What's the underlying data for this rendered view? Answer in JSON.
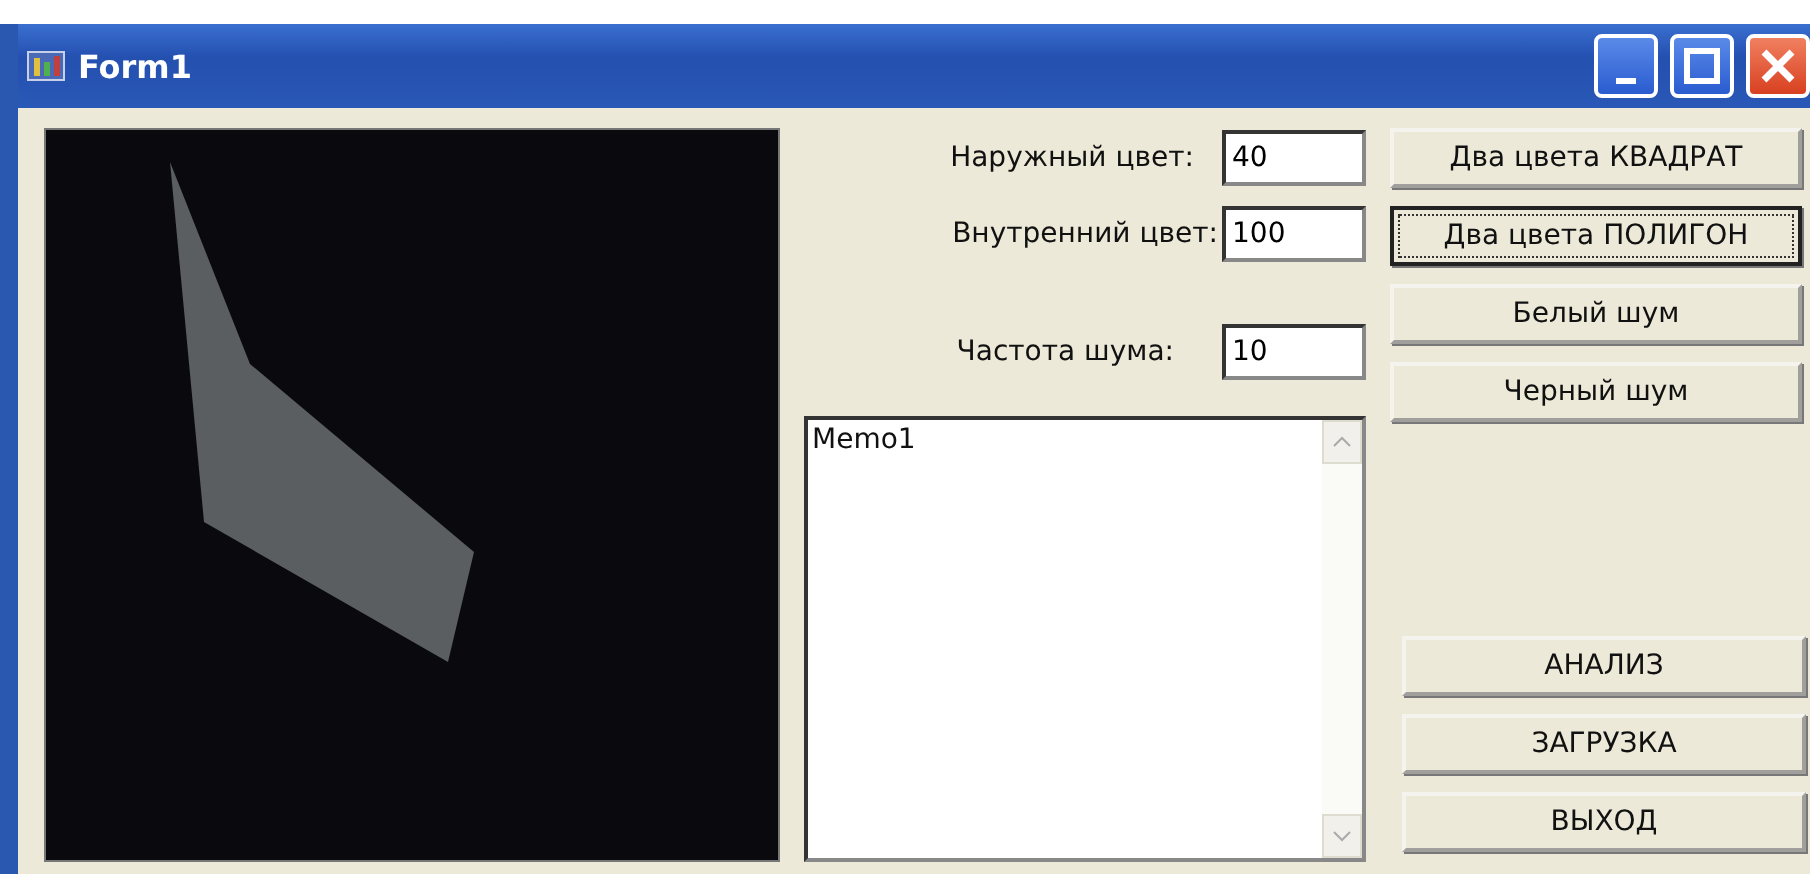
{
  "window": {
    "title": "Form1"
  },
  "fields": [
    {
      "label": "Наружный цвет:",
      "value": "40"
    },
    {
      "label": "Внутренний цвет:",
      "value": "100"
    },
    {
      "label": "Частота шума:",
      "value": "10"
    }
  ],
  "memo": {
    "value": "Memo1"
  },
  "top_buttons": [
    {
      "label": "Два цвета КВАДРАТ",
      "focused": false
    },
    {
      "label": "Два цвета ПОЛИГОН",
      "focused": true
    },
    {
      "label": "Белый шум",
      "focused": false
    },
    {
      "label": "Черный шум",
      "focused": false
    }
  ],
  "bottom_buttons": [
    {
      "label": "АНАЛИЗ",
      "focused": false
    },
    {
      "label": "ЗАГРУЗКА",
      "focused": false
    },
    {
      "label": "ВЫХОД",
      "focused": false
    }
  ]
}
